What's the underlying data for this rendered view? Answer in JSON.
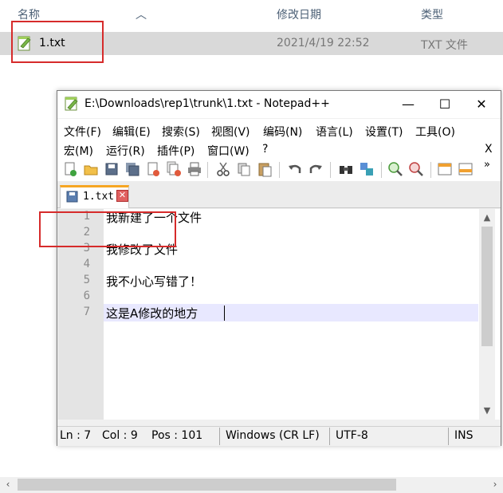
{
  "explorer": {
    "columns": {
      "name": "名称",
      "modified": "修改日期",
      "type": "类型"
    },
    "file": {
      "name": "1.txt",
      "modified": "2021/4/19 22:52",
      "type": "TXT 文件"
    }
  },
  "window": {
    "title": "E:\\Downloads\\rep1\\trunk\\1.txt - Notepad++",
    "minimize": "—",
    "maximize": "☐",
    "close": "✕"
  },
  "menu": {
    "row1": [
      "文件(F)",
      "编辑(E)",
      "搜索(S)",
      "视图(V)",
      "编码(N)",
      "语言(L)",
      "设置(T)",
      "工具(O)"
    ],
    "row2": [
      "宏(M)",
      "运行(R)",
      "插件(P)",
      "窗口(W)",
      "?"
    ],
    "close_doc": "X"
  },
  "tab": {
    "label": "1.txt",
    "close": "✕"
  },
  "editor": {
    "line_numbers": [
      "1",
      "2",
      "3",
      "4",
      "5",
      "6",
      "7"
    ],
    "lines": [
      "我新建了一个文件",
      "",
      "我修改了文件",
      "",
      "我不小心写错了！",
      "",
      "这是A修改的地方"
    ]
  },
  "status": {
    "ln": "Ln : 7",
    "col": "Col : 9",
    "pos": "Pos : 101",
    "eol": "Windows (CR LF)",
    "encoding": "UTF-8",
    "mode": "INS"
  },
  "toolbar_icons": [
    "new-icon",
    "open-icon",
    "save-icon",
    "save-all-icon",
    "close-icon",
    "close-all-icon",
    "print-icon",
    "cut-icon",
    "copy-icon",
    "paste-icon",
    "undo-icon",
    "redo-icon",
    "find-icon",
    "replace-icon",
    "zoom-in-icon",
    "zoom-out-icon",
    "sync-v-icon",
    "sync-h-icon",
    "more-icon"
  ],
  "colors": {
    "tab_accent": "#f6a623",
    "highlight_box": "#d62b2b",
    "current_line": "#e8e8ff"
  }
}
